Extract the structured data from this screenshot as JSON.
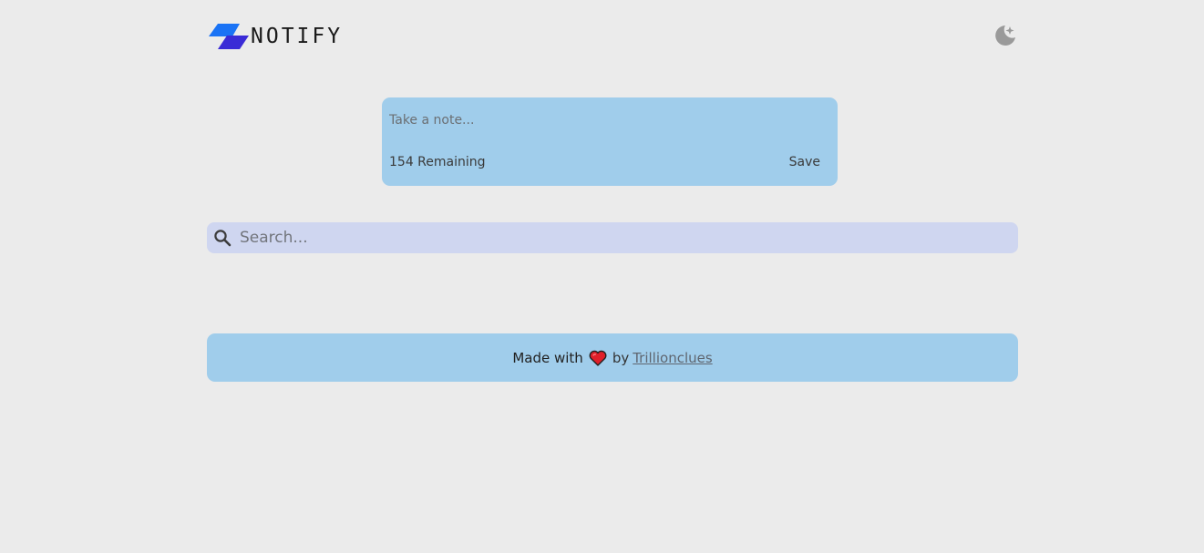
{
  "app": {
    "title": "NOTIFY"
  },
  "header": {
    "theme_toggle_icon": "moon-sparkle-icon"
  },
  "note": {
    "placeholder": "Take a note...",
    "value": "",
    "remaining": "154 Remaining",
    "save_label": "Save"
  },
  "search": {
    "placeholder": "Search...",
    "value": ""
  },
  "footer": {
    "made_with": "Made with",
    "heart_icon": "heart-icon",
    "by": "by",
    "author": "Trillionclues"
  },
  "colors": {
    "background": "#ebebeb",
    "card": "#a0cdeb",
    "search": "#cfd6f0",
    "logo_primary": "#1a73f5",
    "logo_secondary": "#3a2bd6",
    "heart": "#e0202a"
  }
}
